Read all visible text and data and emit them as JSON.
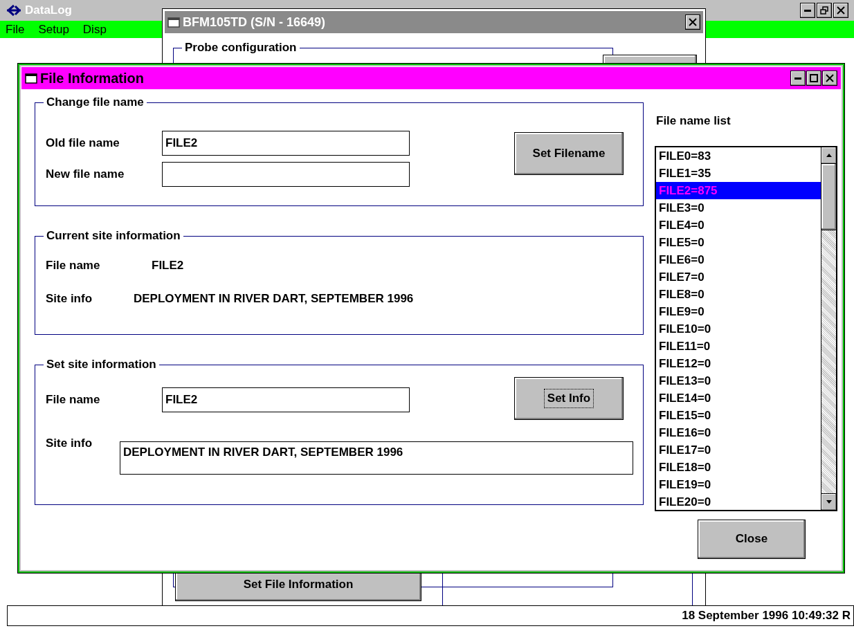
{
  "app": {
    "title": "DataLog",
    "menu": [
      {
        "label": "File"
      },
      {
        "label": "Setup"
      },
      {
        "label": "Disp"
      }
    ]
  },
  "back_window": {
    "title": "BFM105TD (S/N - 16649)",
    "group_title": "Probe configuration",
    "button": "Set File Information"
  },
  "dialog": {
    "title": "File Information",
    "change_file_name": {
      "title": "Change file name",
      "old_label": "Old file name",
      "old_value": "FILE2",
      "new_label": "New file name",
      "button": "Set Filename"
    },
    "current_site": {
      "title": "Current site information",
      "rows": [
        {
          "label": "File name",
          "value": "FILE2"
        },
        {
          "label": "Site info",
          "value": "DEPLOYMENT IN RIVER DART, SEPTEMBER 1996"
        }
      ]
    },
    "set_site": {
      "title": "Set site information",
      "file_label": "File name",
      "file_value": "FILE2",
      "site_label": "Site info",
      "site_value": "DEPLOYMENT IN RIVER DART, SEPTEMBER 1996",
      "button": {
        "label": "Set Info",
        "focused": true
      }
    },
    "file_list": {
      "title": "File name list",
      "items": [
        {
          "label": "FILE0=83",
          "selected": false
        },
        {
          "label": "FILE1=35",
          "selected": false
        },
        {
          "label": "FILE2=875",
          "selected": true
        },
        {
          "label": "FILE3=0",
          "selected": false
        },
        {
          "label": "FILE4=0",
          "selected": false
        },
        {
          "label": "FILE5=0",
          "selected": false
        },
        {
          "label": "FILE6=0",
          "selected": false
        },
        {
          "label": "FILE7=0",
          "selected": false
        },
        {
          "label": "FILE8=0",
          "selected": false
        },
        {
          "label": "FILE9=0",
          "selected": false
        },
        {
          "label": "FILE10=0",
          "selected": false
        },
        {
          "label": "FILE11=0",
          "selected": false
        },
        {
          "label": "FILE12=0",
          "selected": false
        },
        {
          "label": "FILE13=0",
          "selected": false
        },
        {
          "label": "FILE14=0",
          "selected": false
        },
        {
          "label": "FILE15=0",
          "selected": false
        },
        {
          "label": "FILE16=0",
          "selected": false
        },
        {
          "label": "FILE17=0",
          "selected": false
        },
        {
          "label": "FILE18=0",
          "selected": false
        },
        {
          "label": "FILE19=0",
          "selected": false
        },
        {
          "label": "FILE20=0",
          "selected": false
        }
      ]
    },
    "close_button": "Close"
  },
  "status_bar": {
    "text": "18 September 1996 10:49:32 R"
  }
}
